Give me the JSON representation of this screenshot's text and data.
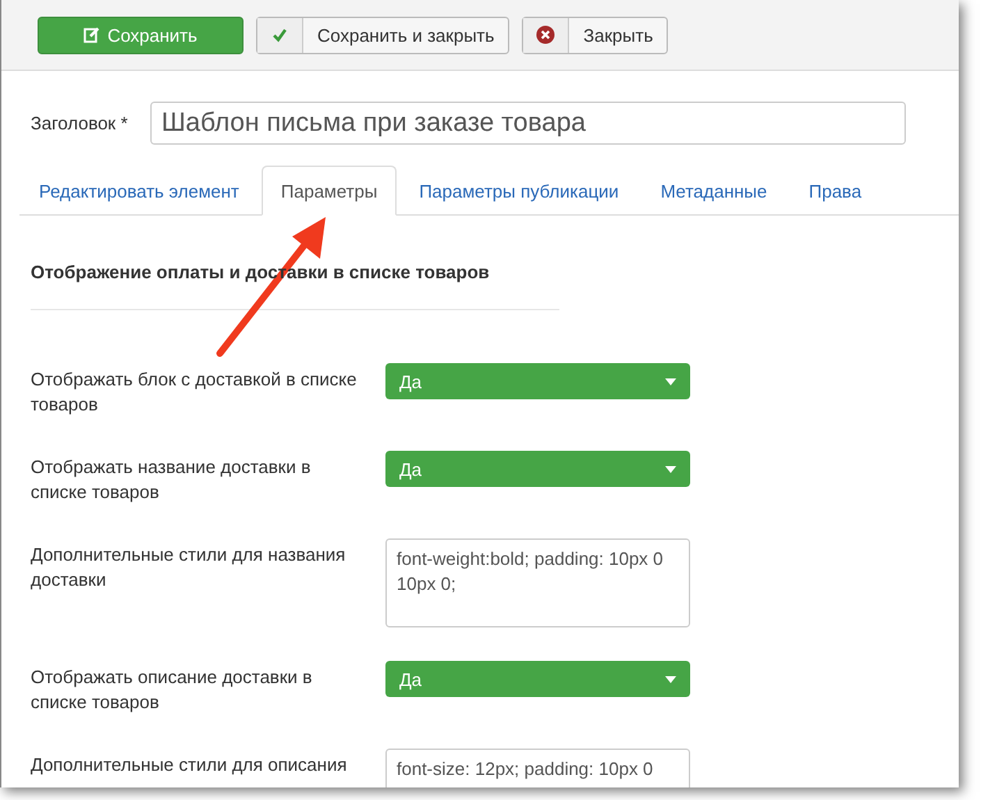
{
  "toolbar": {
    "buttons": [
      {
        "label": "Сохранить",
        "kind": "primary"
      },
      {
        "label": "Сохранить и закрыть",
        "kind": "check"
      },
      {
        "label": "Закрыть",
        "kind": "close"
      }
    ]
  },
  "title_field": {
    "label": "Заголовок *",
    "value": "Шаблон письма при заказе товара"
  },
  "tabs": [
    {
      "label": "Редактировать элемент",
      "selected": false
    },
    {
      "label": "Параметры",
      "selected": true
    },
    {
      "label": "Параметры публикации",
      "selected": false
    },
    {
      "label": "Метаданные",
      "selected": false
    },
    {
      "label": "Права",
      "selected": false
    }
  ],
  "section": {
    "heading": "Отображение оплаты и доставки в списке товаров",
    "fields": [
      {
        "kind": "select",
        "label": "Отображать блок с доставкой в списке товаров",
        "value": "Да"
      },
      {
        "kind": "select",
        "label": "Отображать название доставки в списке товаров",
        "value": "Да"
      },
      {
        "kind": "textarea",
        "label": "Дополнительные стили для названия доставки",
        "value": "font-weight:bold; padding: 10px 0 10px 0;"
      },
      {
        "kind": "select",
        "label": "Отображать описание доставки в списке товаров",
        "value": "Да"
      },
      {
        "kind": "textarea",
        "label": "Дополнительные стили для описания",
        "value": "font-size: 12px; padding: 10px 0"
      }
    ]
  }
}
